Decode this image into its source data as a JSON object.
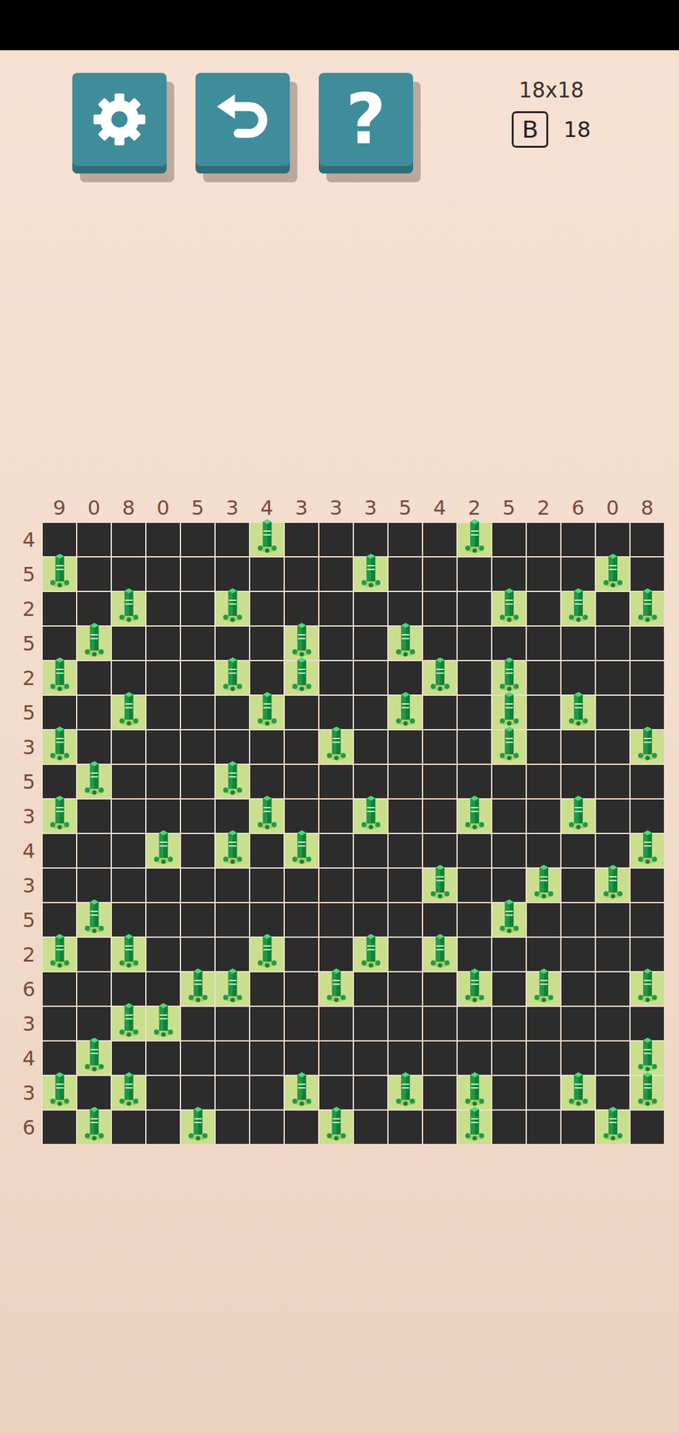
{
  "toolbar": {
    "help_label": "?"
  },
  "info": {
    "size": "18x18",
    "badge": "B",
    "count": "18"
  },
  "column_clues": [
    "9",
    "0",
    "8",
    "0",
    "5",
    "3",
    "4",
    "3",
    "3",
    "3",
    "5",
    "4",
    "2",
    "5",
    "2",
    "6",
    "0",
    "8"
  ],
  "rows": [
    {
      "clue": "4",
      "trees": [
        6,
        12
      ]
    },
    {
      "clue": "5",
      "trees": [
        0,
        9,
        16
      ]
    },
    {
      "clue": "2",
      "trees": [
        2,
        5,
        13,
        15,
        17
      ]
    },
    {
      "clue": "5",
      "trees": [
        1,
        7,
        10
      ]
    },
    {
      "clue": "2",
      "trees": [
        0,
        5,
        7,
        11,
        13
      ]
    },
    {
      "clue": "5",
      "trees": [
        2,
        6,
        10,
        13,
        15
      ]
    },
    {
      "clue": "3",
      "trees": [
        0,
        8,
        13,
        17
      ]
    },
    {
      "clue": "5",
      "trees": [
        1,
        5
      ]
    },
    {
      "clue": "3",
      "trees": [
        0,
        6,
        9,
        12,
        15
      ]
    },
    {
      "clue": "4",
      "trees": [
        3,
        5,
        7,
        17
      ]
    },
    {
      "clue": "3",
      "trees": [
        11,
        14,
        16
      ]
    },
    {
      "clue": "5",
      "trees": [
        1,
        13
      ]
    },
    {
      "clue": "2",
      "trees": [
        0,
        2,
        6,
        9,
        11
      ]
    },
    {
      "clue": "6",
      "trees": [
        4,
        5,
        8,
        12,
        14,
        17
      ]
    },
    {
      "clue": "3",
      "trees": [
        2,
        3
      ]
    },
    {
      "clue": "4",
      "trees": [
        1,
        17
      ]
    },
    {
      "clue": "3",
      "trees": [
        0,
        2,
        7,
        10,
        12,
        15,
        17
      ]
    },
    {
      "clue": "6",
      "trees": [
        1,
        4,
        8,
        12,
        16
      ]
    }
  ]
}
